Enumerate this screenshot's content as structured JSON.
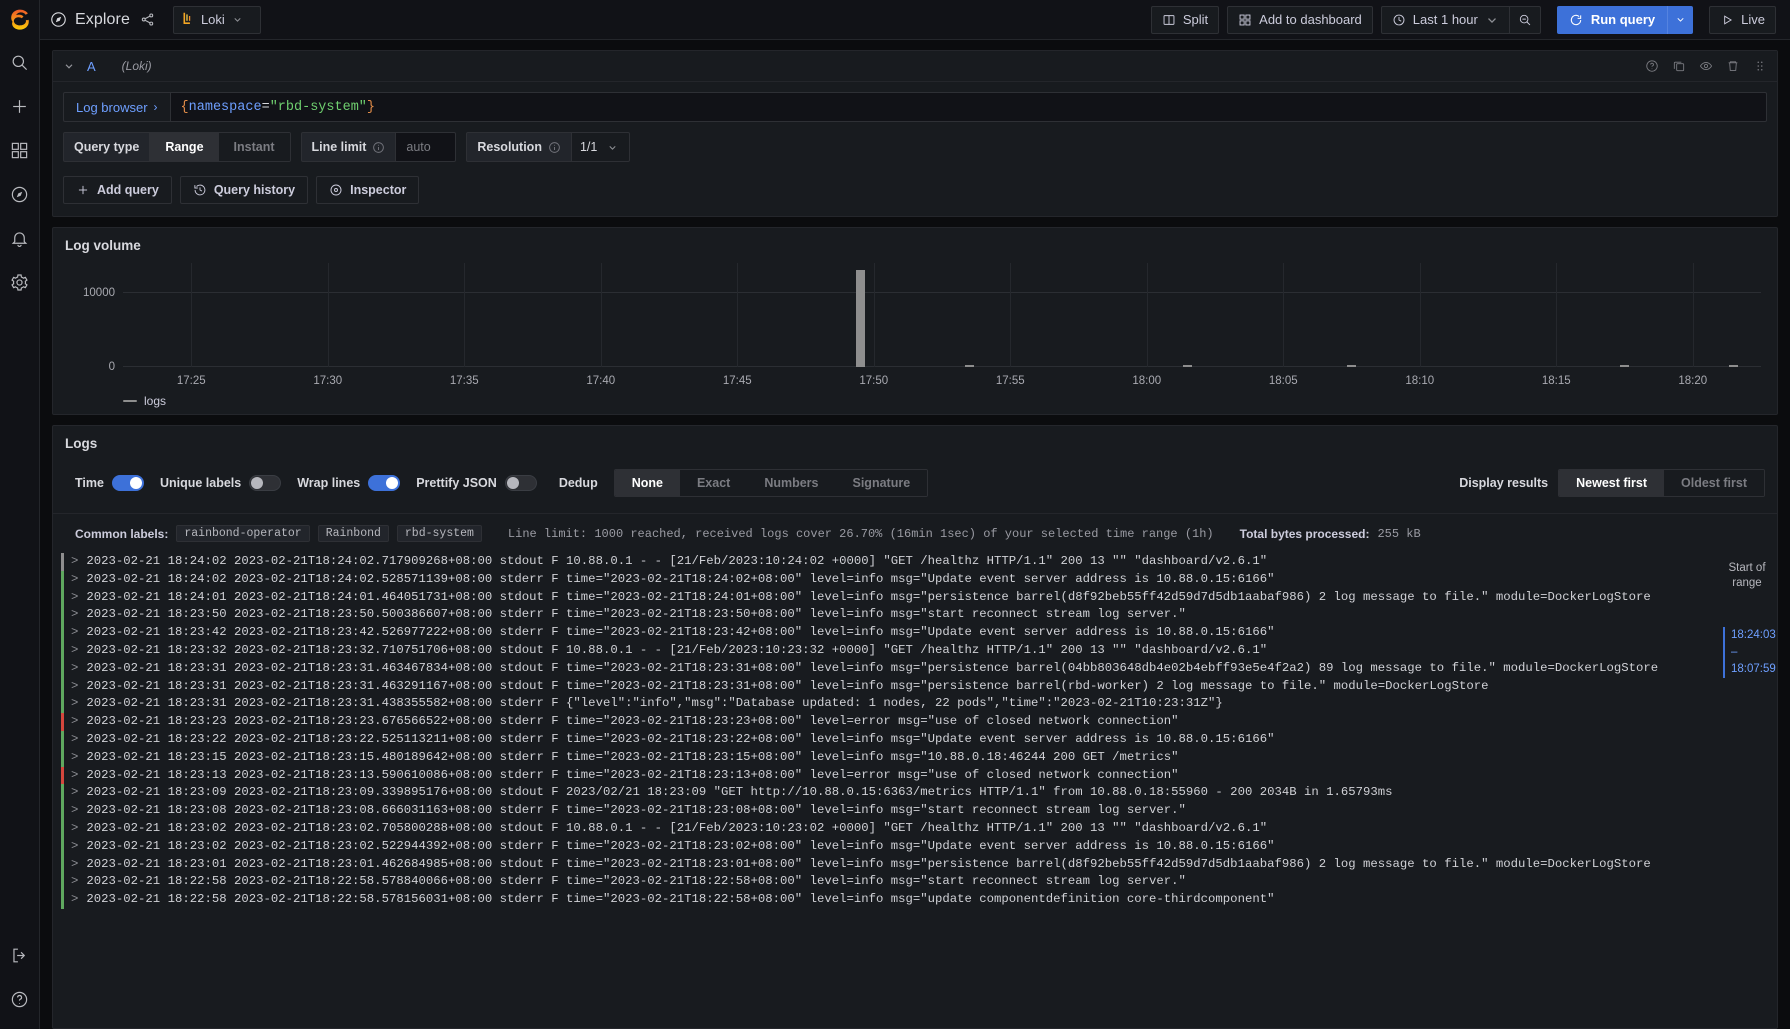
{
  "nav": {
    "logo": "grafana-logo",
    "items": [
      {
        "name": "search",
        "label": "Search"
      },
      {
        "name": "add",
        "label": "Create"
      },
      {
        "name": "dashboards",
        "label": "Dashboards"
      },
      {
        "name": "explore",
        "label": "Explore"
      },
      {
        "name": "alerting",
        "label": "Alerting"
      },
      {
        "name": "configuration",
        "label": "Configuration"
      }
    ],
    "bottom": [
      {
        "name": "signout",
        "label": "Sign out"
      },
      {
        "name": "help",
        "label": "Help"
      }
    ]
  },
  "topbar": {
    "title": "Explore",
    "datasource": "Loki",
    "split_label": "Split",
    "add_to_dashboard_label": "Add to dashboard",
    "time_range_label": "Last 1 hour",
    "run_query_label": "Run query",
    "live_label": "Live",
    "accent_color": "#3d71d9"
  },
  "query": {
    "ref_id": "A",
    "datasource_note": "(Loki)",
    "log_browser_label": "Log browser",
    "log_browser_arrow": "›",
    "expression": {
      "open_brace": "{",
      "label": "namespace",
      "operator": "=",
      "value": "\"rbd-system\"",
      "close_brace": "}"
    },
    "options": {
      "query_type_label": "Query type",
      "query_type_options": [
        "Range",
        "Instant"
      ],
      "query_type_selected": "Range",
      "line_limit_label": "Line limit",
      "line_limit_placeholder": "auto",
      "line_limit_value": "",
      "resolution_label": "Resolution",
      "resolution_value": "1/1"
    },
    "actions": {
      "add_query_label": "Add query",
      "query_history_label": "Query history",
      "inspector_label": "Inspector"
    }
  },
  "log_volume": {
    "title": "Log volume",
    "legend_label": "logs"
  },
  "chart_data": {
    "type": "bar",
    "title": "Log volume",
    "xlabel": "",
    "ylabel": "",
    "ylim": [
      0,
      14000
    ],
    "yticks": [
      0,
      10000
    ],
    "ytick_labels": [
      "0",
      "10000"
    ],
    "grid": true,
    "legend_position": "bottom-left",
    "x_tick_labels": [
      "17:25",
      "17:30",
      "17:35",
      "17:40",
      "17:45",
      "17:50",
      "17:55",
      "18:00",
      "18:05",
      "18:10",
      "18:15",
      "18:20"
    ],
    "series": [
      {
        "name": "logs",
        "color": "#8e8e8e",
        "x": [
          "17:25",
          "17:27",
          "17:29",
          "17:31",
          "17:33",
          "17:35",
          "17:37",
          "17:39",
          "17:41",
          "17:43",
          "17:45",
          "17:47",
          "17:49",
          "17:51",
          "17:53",
          "17:55",
          "17:57",
          "17:59",
          "18:01",
          "18:03",
          "18:05",
          "18:07",
          "18:09",
          "18:11",
          "18:13",
          "18:15",
          "18:17",
          "18:19",
          "18:21",
          "18:23"
        ],
        "values": [
          0,
          0,
          0,
          0,
          0,
          0,
          0,
          0,
          0,
          0,
          0,
          0,
          0,
          13000,
          0,
          120,
          0,
          0,
          0,
          220,
          0,
          0,
          260,
          0,
          0,
          0,
          0,
          180,
          0,
          110
        ]
      }
    ]
  },
  "logs": {
    "title": "Logs",
    "controls": {
      "time_label": "Time",
      "time_on": true,
      "unique_labels_label": "Unique labels",
      "unique_labels_on": false,
      "wrap_lines_label": "Wrap lines",
      "wrap_lines_on": true,
      "prettify_json_label": "Prettify JSON",
      "prettify_json_on": false,
      "dedup_label": "Dedup",
      "dedup_options": [
        "None",
        "Exact",
        "Numbers",
        "Signature"
      ],
      "dedup_selected": "None",
      "display_results_label": "Display results",
      "order_options": [
        "Newest first",
        "Oldest first"
      ],
      "order_selected": "Newest first"
    },
    "meta": {
      "common_labels_label": "Common labels:",
      "common_labels": [
        "rainbond-operator",
        "Rainbond",
        "rbd-system"
      ],
      "line_limit_text": "Line limit: 1000 reached, received logs cover 26.70% (16min 1sec) of your selected time range (1h)",
      "total_bytes_label": "Total bytes processed:",
      "total_bytes_value": "255 kB"
    },
    "gutter": {
      "start_of_range": "Start of range",
      "range_top": "18:24:03",
      "range_dash": "–",
      "range_bottom": "18:07:59"
    },
    "rows": [
      {
        "level": "unknown",
        "text": "2023-02-21 18:24:02 2023-02-21T18:24:02.717909268+08:00 stdout F 10.88.0.1 - - [21/Feb/2023:10:24:02 +0000] \"GET /healthz HTTP/1.1\" 200 13 \"\" \"dashboard/v2.6.1\""
      },
      {
        "level": "info",
        "text": "2023-02-21 18:24:02 2023-02-21T18:24:02.528571139+08:00 stderr F time=\"2023-02-21T18:24:02+08:00\" level=info msg=\"Update event server address is 10.88.0.15:6166\""
      },
      {
        "level": "info",
        "text": "2023-02-21 18:24:01 2023-02-21T18:24:01.464051731+08:00 stdout F time=\"2023-02-21T18:24:01+08:00\" level=info msg=\"persistence barrel(d8f92beb55ff42d59d7d5db1aabaf986) 2 log message to file.\" module=DockerLogStore"
      },
      {
        "level": "info",
        "text": "2023-02-21 18:23:50 2023-02-21T18:23:50.500386607+08:00 stderr F time=\"2023-02-21T18:23:50+08:00\" level=info msg=\"start reconnect stream log server.\""
      },
      {
        "level": "info",
        "text": "2023-02-21 18:23:42 2023-02-21T18:23:42.526977222+08:00 stderr F time=\"2023-02-21T18:23:42+08:00\" level=info msg=\"Update event server address is 10.88.0.15:6166\""
      },
      {
        "level": "info",
        "text": "2023-02-21 18:23:32 2023-02-21T18:23:32.710751706+08:00 stdout F 10.88.0.1 - - [21/Feb/2023:10:23:32 +0000] \"GET /healthz HTTP/1.1\" 200 13 \"\" \"dashboard/v2.6.1\""
      },
      {
        "level": "info",
        "text": "2023-02-21 18:23:31 2023-02-21T18:23:31.463467834+08:00 stdout F time=\"2023-02-21T18:23:31+08:00\" level=info msg=\"persistence barrel(04bb803648db4e02b4ebff93e5e4f2a2) 89 log message to file.\" module=DockerLogStore"
      },
      {
        "level": "info",
        "text": "2023-02-21 18:23:31 2023-02-21T18:23:31.463291167+08:00 stdout F time=\"2023-02-21T18:23:31+08:00\" level=info msg=\"persistence barrel(rbd-worker) 2 log message to file.\" module=DockerLogStore"
      },
      {
        "level": "info",
        "text": "2023-02-21 18:23:31 2023-02-21T18:23:31.438355582+08:00 stderr F {\"level\":\"info\",\"msg\":\"Database updated: 1 nodes, 22 pods\",\"time\":\"2023-02-21T10:23:31Z\"}"
      },
      {
        "level": "error",
        "text": "2023-02-21 18:23:23 2023-02-21T18:23:23.676566522+08:00 stderr F time=\"2023-02-21T18:23:23+08:00\" level=error msg=\"use of closed network connection\""
      },
      {
        "level": "info",
        "text": "2023-02-21 18:23:22 2023-02-21T18:23:22.525113211+08:00 stderr F time=\"2023-02-21T18:23:22+08:00\" level=info msg=\"Update event server address is 10.88.0.15:6166\""
      },
      {
        "level": "info",
        "text": "2023-02-21 18:23:15 2023-02-21T18:23:15.480189642+08:00 stderr F time=\"2023-02-21T18:23:15+08:00\" level=info msg=\"10.88.0.18:46244 200 GET /metrics\""
      },
      {
        "level": "error",
        "text": "2023-02-21 18:23:13 2023-02-21T18:23:13.590610086+08:00 stderr F time=\"2023-02-21T18:23:13+08:00\" level=error msg=\"use of closed network connection\""
      },
      {
        "level": "info",
        "text": "2023-02-21 18:23:09 2023-02-21T18:23:09.339895176+08:00 stdout F 2023/02/21 18:23:09 \"GET http://10.88.0.15:6363/metrics HTTP/1.1\" from 10.88.0.18:55960 - 200 2034B in 1.65793ms"
      },
      {
        "level": "info",
        "text": "2023-02-21 18:23:08 2023-02-21T18:23:08.666031163+08:00 stderr F time=\"2023-02-21T18:23:08+08:00\" level=info msg=\"start reconnect stream log server.\""
      },
      {
        "level": "info",
        "text": "2023-02-21 18:23:02 2023-02-21T18:23:02.705800288+08:00 stdout F 10.88.0.1 - - [21/Feb/2023:10:23:02 +0000] \"GET /healthz HTTP/1.1\" 200 13 \"\" \"dashboard/v2.6.1\""
      },
      {
        "level": "info",
        "text": "2023-02-21 18:23:02 2023-02-21T18:23:02.522944392+08:00 stderr F time=\"2023-02-21T18:23:02+08:00\" level=info msg=\"Update event server address is 10.88.0.15:6166\""
      },
      {
        "level": "info",
        "text": "2023-02-21 18:23:01 2023-02-21T18:23:01.462684985+08:00 stdout F time=\"2023-02-21T18:23:01+08:00\" level=info msg=\"persistence barrel(d8f92beb55ff42d59d7d5db1aabaf986) 2 log message to file.\" module=DockerLogStore"
      },
      {
        "level": "info",
        "text": "2023-02-21 18:22:58 2023-02-21T18:22:58.578840066+08:00 stderr F time=\"2023-02-21T18:22:58+08:00\" level=info msg=\"start reconnect stream log server.\""
      },
      {
        "level": "info",
        "text": "2023-02-21 18:22:58 2023-02-21T18:22:58.578156031+08:00 stderr F time=\"2023-02-21T18:22:58+08:00\" level=info msg=\"update componentdefinition core-thirdcomponent\""
      }
    ]
  }
}
